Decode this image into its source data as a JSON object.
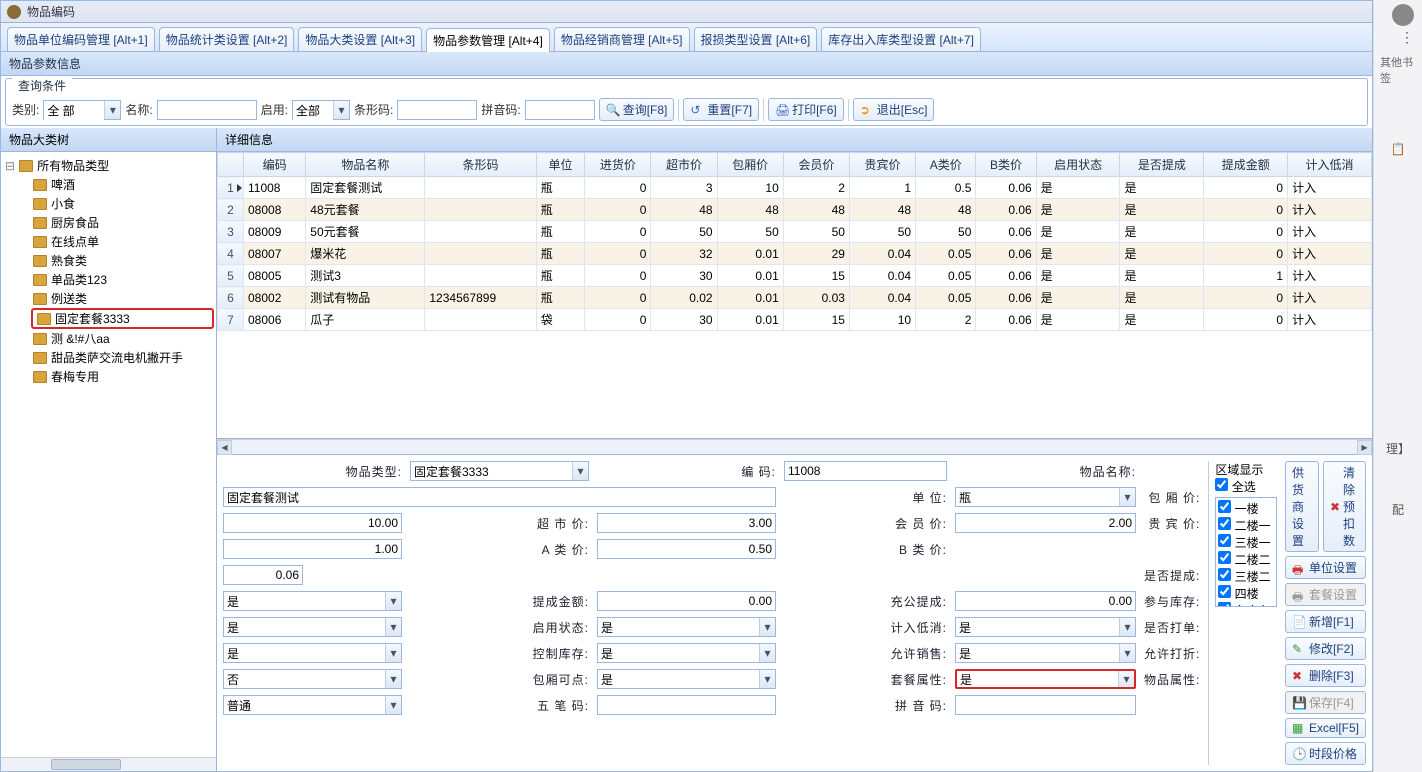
{
  "window": {
    "title": "物品编码"
  },
  "tabs": [
    {
      "label": "物品单位编码管理 [Alt+1]"
    },
    {
      "label": "物品统计类设置 [Alt+2]"
    },
    {
      "label": "物品大类设置 [Alt+3]"
    },
    {
      "label": "物品参数管理 [Alt+4]"
    },
    {
      "label": "物品经销商管理 [Alt+5]"
    },
    {
      "label": "报损类型设置 [Alt+6]"
    },
    {
      "label": "库存出入库类型设置 [Alt+7]"
    }
  ],
  "active_tab": 3,
  "section_title": "物品参数信息",
  "query": {
    "legend": "查询条件",
    "category_label": "类别:",
    "category_value": "全 部",
    "name_label": "名称:",
    "enable_label": "启用:",
    "enable_value": "全部",
    "barcode_label": "条形码:",
    "pinyin_label": "拼音码:",
    "buttons": {
      "search": "查询[F8]",
      "reset": "重置[F7]",
      "print": "打印[F6]",
      "exit": "退出[Esc]"
    }
  },
  "tree": {
    "header": "物品大类树",
    "root": "所有物品类型",
    "children": [
      "啤酒",
      "小食",
      "厨房食品",
      "在线点单",
      "熟食类",
      "单品类123",
      "例送类",
      "固定套餐3333",
      "测 &!#八aa",
      "甜品类萨交流电机撇开手",
      "春梅专用"
    ],
    "highlight_index": 7
  },
  "detail_header": "详细信息",
  "grid": {
    "headers": [
      "编码",
      "物品名称",
      "条形码",
      "单位",
      "进货价",
      "超市价",
      "包厢价",
      "会员价",
      "贵宾价",
      "A类价",
      "B类价",
      "启用状态",
      "是否提成",
      "提成金额",
      "计入低消"
    ],
    "rows": [
      {
        "cells": [
          "11008",
          "固定套餐测试",
          "",
          "瓶",
          "0",
          "3",
          "10",
          "2",
          "1",
          "0.5",
          "0.06",
          "是",
          "是",
          "0",
          "计入"
        ],
        "current": true
      },
      {
        "cells": [
          "08008",
          "48元套餐",
          "",
          "瓶",
          "0",
          "48",
          "48",
          "48",
          "48",
          "48",
          "0.06",
          "是",
          "是",
          "0",
          "计入"
        ]
      },
      {
        "cells": [
          "08009",
          "50元套餐",
          "",
          "瓶",
          "0",
          "50",
          "50",
          "50",
          "50",
          "50",
          "0.06",
          "是",
          "是",
          "0",
          "计入"
        ]
      },
      {
        "cells": [
          "08007",
          "爆米花",
          "",
          "瓶",
          "0",
          "32",
          "0.01",
          "29",
          "0.04",
          "0.05",
          "0.06",
          "是",
          "是",
          "0",
          "计入"
        ]
      },
      {
        "cells": [
          "08005",
          "测试3",
          "",
          "瓶",
          "0",
          "30",
          "0.01",
          "15",
          "0.04",
          "0.05",
          "0.06",
          "是",
          "是",
          "1",
          "计入"
        ]
      },
      {
        "cells": [
          "08002",
          "测试有物品",
          "1234567899",
          "瓶",
          "0",
          "0.02",
          "0.01",
          "0.03",
          "0.04",
          "0.05",
          "0.06",
          "是",
          "是",
          "0",
          "计入"
        ]
      },
      {
        "cells": [
          "08006",
          "瓜子",
          "",
          "袋",
          "0",
          "30",
          "0.01",
          "15",
          "10",
          "2",
          "0.06",
          "是",
          "是",
          "0",
          "计入"
        ]
      }
    ],
    "numeric_cols": [
      4,
      5,
      6,
      7,
      8,
      9,
      10,
      13
    ]
  },
  "form": {
    "type": {
      "label": "物品类型:",
      "value": "固定套餐3333"
    },
    "code": {
      "label": "编    码:",
      "value": "11008"
    },
    "name": {
      "label": "物品名称:",
      "value": "固定套餐测试"
    },
    "unit": {
      "label": "单    位:",
      "value": "瓶"
    },
    "box_price": {
      "label": "包 厢 价:",
      "value": "10.00"
    },
    "market_price": {
      "label": "超 市 价:",
      "value": "3.00"
    },
    "member_price": {
      "label": "会 员 价:",
      "value": "2.00"
    },
    "vip_price": {
      "label": "贵 宾 价:",
      "value": "1.00"
    },
    "a_price": {
      "label": "A 类 价:",
      "value": "0.50"
    },
    "b_price": {
      "label": "B 类 价:",
      "value": "0.06"
    },
    "commission": {
      "label": "是否提成:",
      "value": "是"
    },
    "commission_amt": {
      "label": "提成金额:",
      "value": "0.00"
    },
    "charge_commission": {
      "label": "充公提成:",
      "value": "0.00"
    },
    "stock_in": {
      "label": "参与库存:",
      "value": "是"
    },
    "enable": {
      "label": "启用状态:",
      "value": "是"
    },
    "count_low": {
      "label": "计入低消:",
      "value": "是"
    },
    "single": {
      "label": "是否打单:",
      "value": "是"
    },
    "ctrl_stock": {
      "label": "控制库存:",
      "value": "是"
    },
    "allow_sale": {
      "label": "允许销售:",
      "value": "是"
    },
    "allow_disc": {
      "label": "允许打折:",
      "value": "否"
    },
    "box_click": {
      "label": "包厢可点:",
      "value": "是"
    },
    "combo_attr": {
      "label": "套餐属性:",
      "value": "是"
    },
    "item_attr": {
      "label": "物品属性:",
      "value": "普通"
    },
    "wubi": {
      "label": "五 笔 码:",
      "value": ""
    },
    "pinyin2": {
      "label": "拼 音 码:",
      "value": ""
    }
  },
  "zone": {
    "title": "区域显示",
    "select_all": "全选",
    "items": [
      "一楼",
      "二楼一",
      "三楼一",
      "二楼二",
      "三楼二",
      "四楼",
      "名字七"
    ]
  },
  "actions": {
    "supplier": "供货商设置",
    "clear": "清除预扣数",
    "unit": "单位设置",
    "combo": "套餐设置",
    "add": "新增[F1]",
    "edit": "修改[F2]",
    "delete": "删除[F3]",
    "save": "保存[F4]",
    "excel": "Excel[F5]",
    "period": "时段价格"
  },
  "right_bar": {
    "bookmark": "其他书签",
    "item1": "理】",
    "item2": "配"
  }
}
